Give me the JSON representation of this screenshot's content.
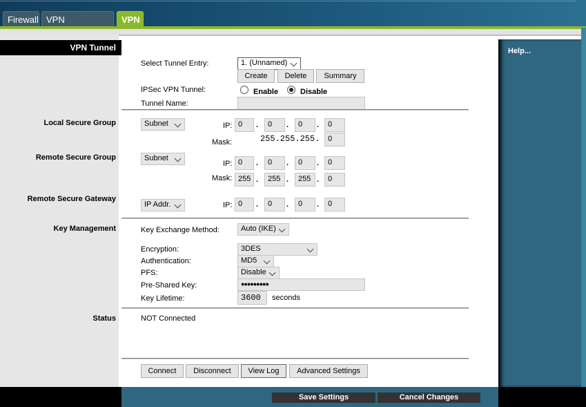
{
  "tabs": [
    {
      "label": "Firewall"
    },
    {
      "label": "VPN Passthrough"
    },
    {
      "label": "VPN",
      "active": true
    }
  ],
  "section_title": "VPN Tunnel",
  "help": "Help...",
  "tunnel": {
    "select_label": "Select Tunnel Entry:",
    "select_value": "1. (Unnamed)",
    "create": "Create",
    "delete": "Delete",
    "summary": "Summary",
    "ipsec_label": "IPSec VPN Tunnel:",
    "enable": "Enable",
    "disable": "Disable",
    "selected": "Disable",
    "name_label": "Tunnel Name:",
    "name_value": ""
  },
  "local": {
    "title": "Local Secure Group",
    "type": "Subnet",
    "ip_label": "IP:",
    "ip": [
      "0",
      "0",
      "0",
      "0"
    ],
    "mask_label": "Mask:",
    "mask_prefix": "255.255.255.",
    "mask_last": "0"
  },
  "remote": {
    "title": "Remote Secure Group",
    "type": "Subnet",
    "ip_label": "IP:",
    "ip": [
      "0",
      "0",
      "0",
      "0"
    ],
    "mask_label": "Mask:",
    "mask": [
      "255",
      "255",
      "255",
      "0"
    ]
  },
  "gateway": {
    "title": "Remote Secure Gateway",
    "type": "IP Addr.",
    "ip_label": "IP:",
    "ip": [
      "0",
      "0",
      "0",
      "0"
    ]
  },
  "key": {
    "title": "Key Management",
    "method_label": "Key Exchange Method:",
    "method": "Auto (IKE)",
    "enc_label": "Encryption:",
    "enc": "3DES",
    "auth_label": "Authentication:",
    "auth": "MD5",
    "pfs_label": "PFS:",
    "pfs": "Disable",
    "psk_label": "Pre-Shared Key:",
    "psk": "●●●●●●●●●",
    "life_label": "Key Lifetime:",
    "life": "3600",
    "life_unit": "seconds"
  },
  "status": {
    "title": "Status",
    "value": "NOT Connected"
  },
  "actions": {
    "connect": "Connect",
    "disconnect": "Disconnect",
    "view_log": "View Log",
    "advanced": "Advanced Settings"
  },
  "footer": {
    "save": "Save Settings",
    "cancel": "Cancel Changes"
  },
  "colors": {
    "accent": "#8bb82a",
    "panel": "#2f6680"
  }
}
